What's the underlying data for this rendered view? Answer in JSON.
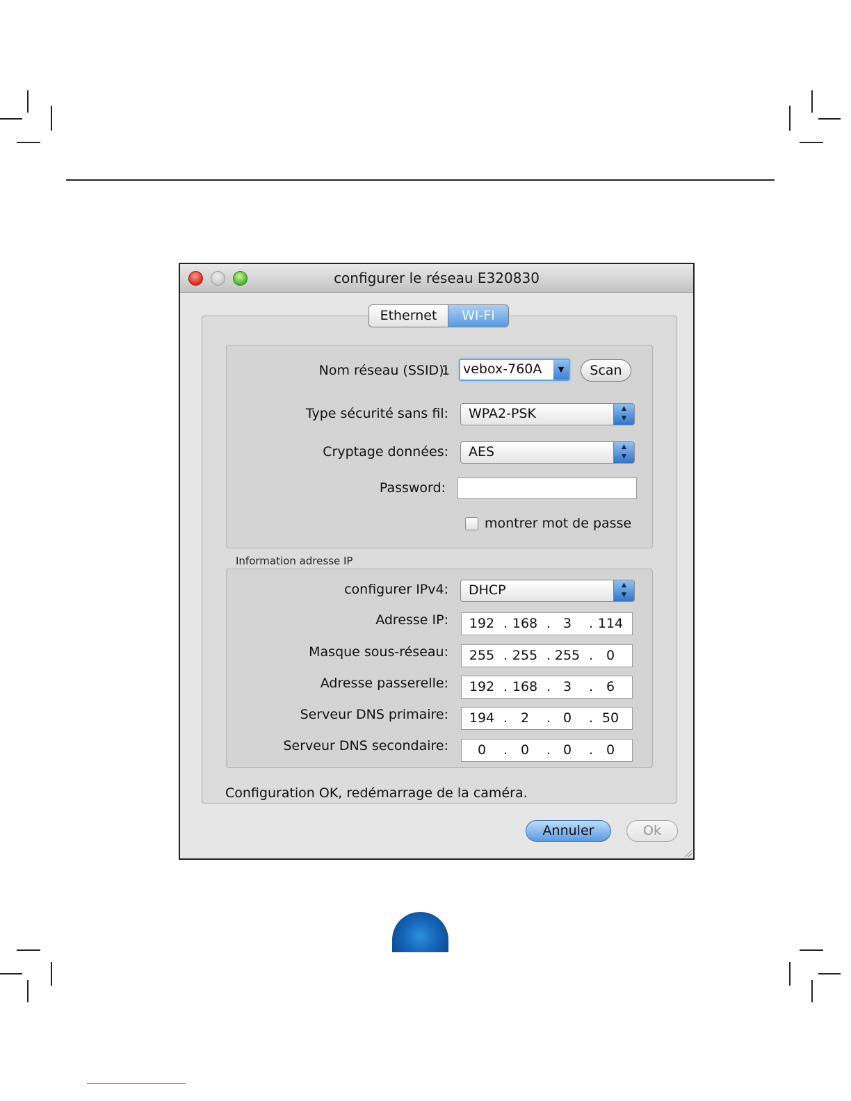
{
  "window": {
    "title": "configurer le réseau E320830"
  },
  "tabs": {
    "ethernet": "Ethernet",
    "wifi": "WI-FI",
    "selected": "WI-FI"
  },
  "wifi": {
    "ssid_label": "Nom réseau (SSID):",
    "ssid_index": "1",
    "ssid_value": "vebox-760A",
    "scan_button": "Scan",
    "security_label": "Type sécurité sans fil:",
    "security_value": "WPA2-PSK",
    "encryption_label": "Cryptage données:",
    "encryption_value": "AES",
    "password_label": "Password:",
    "password_value": "",
    "show_password_label": "montrer mot de passe",
    "show_password_checked": false
  },
  "ip": {
    "group_title": "Information adresse IP",
    "ipv4_label": "configurer IPv4:",
    "ipv4_value": "DHCP",
    "address_label": "Adresse IP:",
    "address": [
      "192",
      "168",
      "3",
      "114"
    ],
    "mask_label": "Masque sous-réseau:",
    "mask": [
      "255",
      "255",
      "255",
      "0"
    ],
    "gateway_label": "Adresse passerelle:",
    "gateway": [
      "192",
      "168",
      "3",
      "6"
    ],
    "dns1_label": "Serveur DNS primaire:",
    "dns1": [
      "194",
      "2",
      "0",
      "50"
    ],
    "dns2_label": "Serveur DNS secondaire:",
    "dns2": [
      "0",
      "0",
      "0",
      "0"
    ],
    "separator": "."
  },
  "status": {
    "message": "Configuration OK, redémarrage de la caméra."
  },
  "buttons": {
    "cancel": "Annuler",
    "ok": "Ok"
  },
  "colors": {
    "accent_blue": "#5d9be0",
    "close_red": "#d8271c",
    "maximize_green": "#4fb22a",
    "page_dot_blue": "#1565b8"
  }
}
